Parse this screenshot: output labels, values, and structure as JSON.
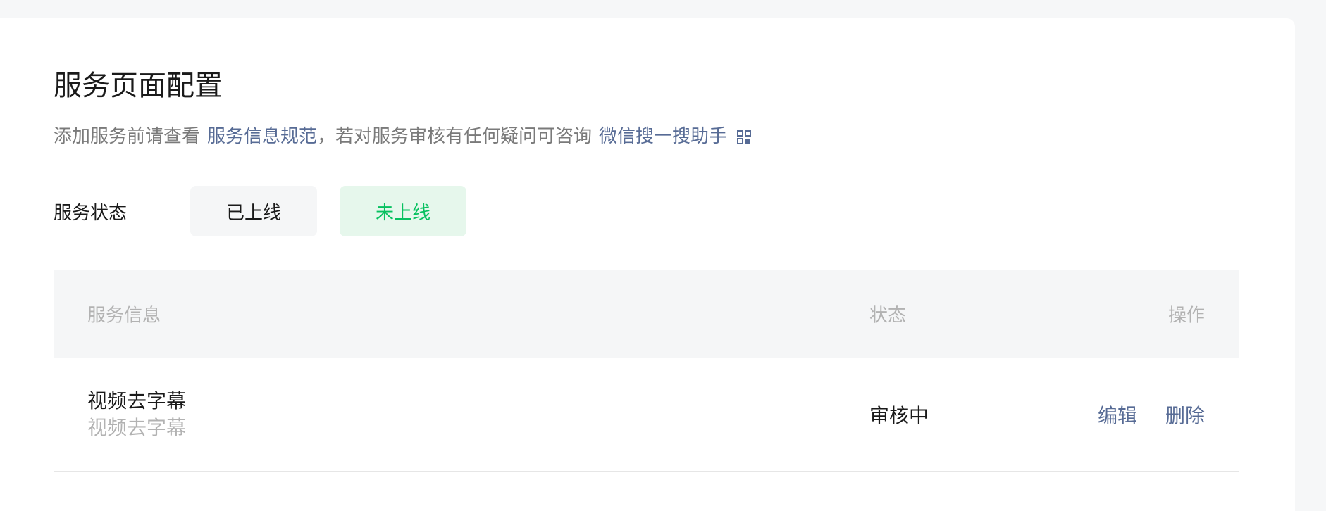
{
  "page": {
    "title": "服务页面配置",
    "desc_prefix": "添加服务前请查看",
    "desc_link1": "服务信息规范",
    "desc_middle": "，若对服务审核有任何疑问可咨询",
    "desc_link2": "微信搜一搜助手",
    "desc_link2_icon": "qrcode-icon"
  },
  "status_filter": {
    "label": "服务状态",
    "options": [
      "已上线",
      "未上线"
    ],
    "selected": "未上线"
  },
  "table": {
    "headers": {
      "info": "服务信息",
      "status": "状态",
      "action": "操作"
    },
    "rows": [
      {
        "name": "视频去字幕",
        "subtitle": "视频去字幕",
        "status": "审核中",
        "actions": [
          "编辑",
          "删除"
        ]
      }
    ]
  },
  "colors": {
    "link": "#576b95",
    "accent_green": "#07c160",
    "accent_green_bg": "#e6f7ec"
  }
}
